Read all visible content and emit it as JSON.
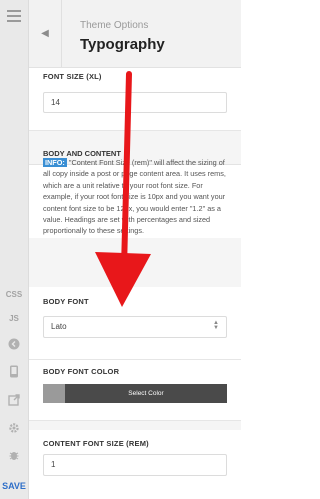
{
  "rail": {
    "css": "CSS",
    "js": "JS",
    "save": "SAVE"
  },
  "header": {
    "breadcrumb": "Theme Options",
    "title": "Typography"
  },
  "font_size_xl": {
    "label": "FONT SIZE (XL)",
    "value": "14"
  },
  "body_and_content": {
    "heading": "BODY AND CONTENT",
    "info_badge": "INFO:",
    "info_text": "\"Content Font Size (rem)\" will affect the sizing of all copy inside a post or page content area. It uses rems, which are a unit relative to your root font size. For example, if your root font size is 10px and you want your content font size to be 12px, you would enter \"1.2\" as a value. Headings are set with percentages and sized proportionally to these settings."
  },
  "body_font": {
    "label": "BODY FONT",
    "value": "Lato"
  },
  "body_font_color": {
    "label": "BODY FONT COLOR",
    "button": "Select Color",
    "swatch_color": "#9a9a9a"
  },
  "content_font_size": {
    "label": "CONTENT FONT SIZE (REM)",
    "value": "1"
  },
  "colors": {
    "accent": "#2f6fc8",
    "arrow": "#e8171a",
    "info": "#3a8fd4"
  }
}
